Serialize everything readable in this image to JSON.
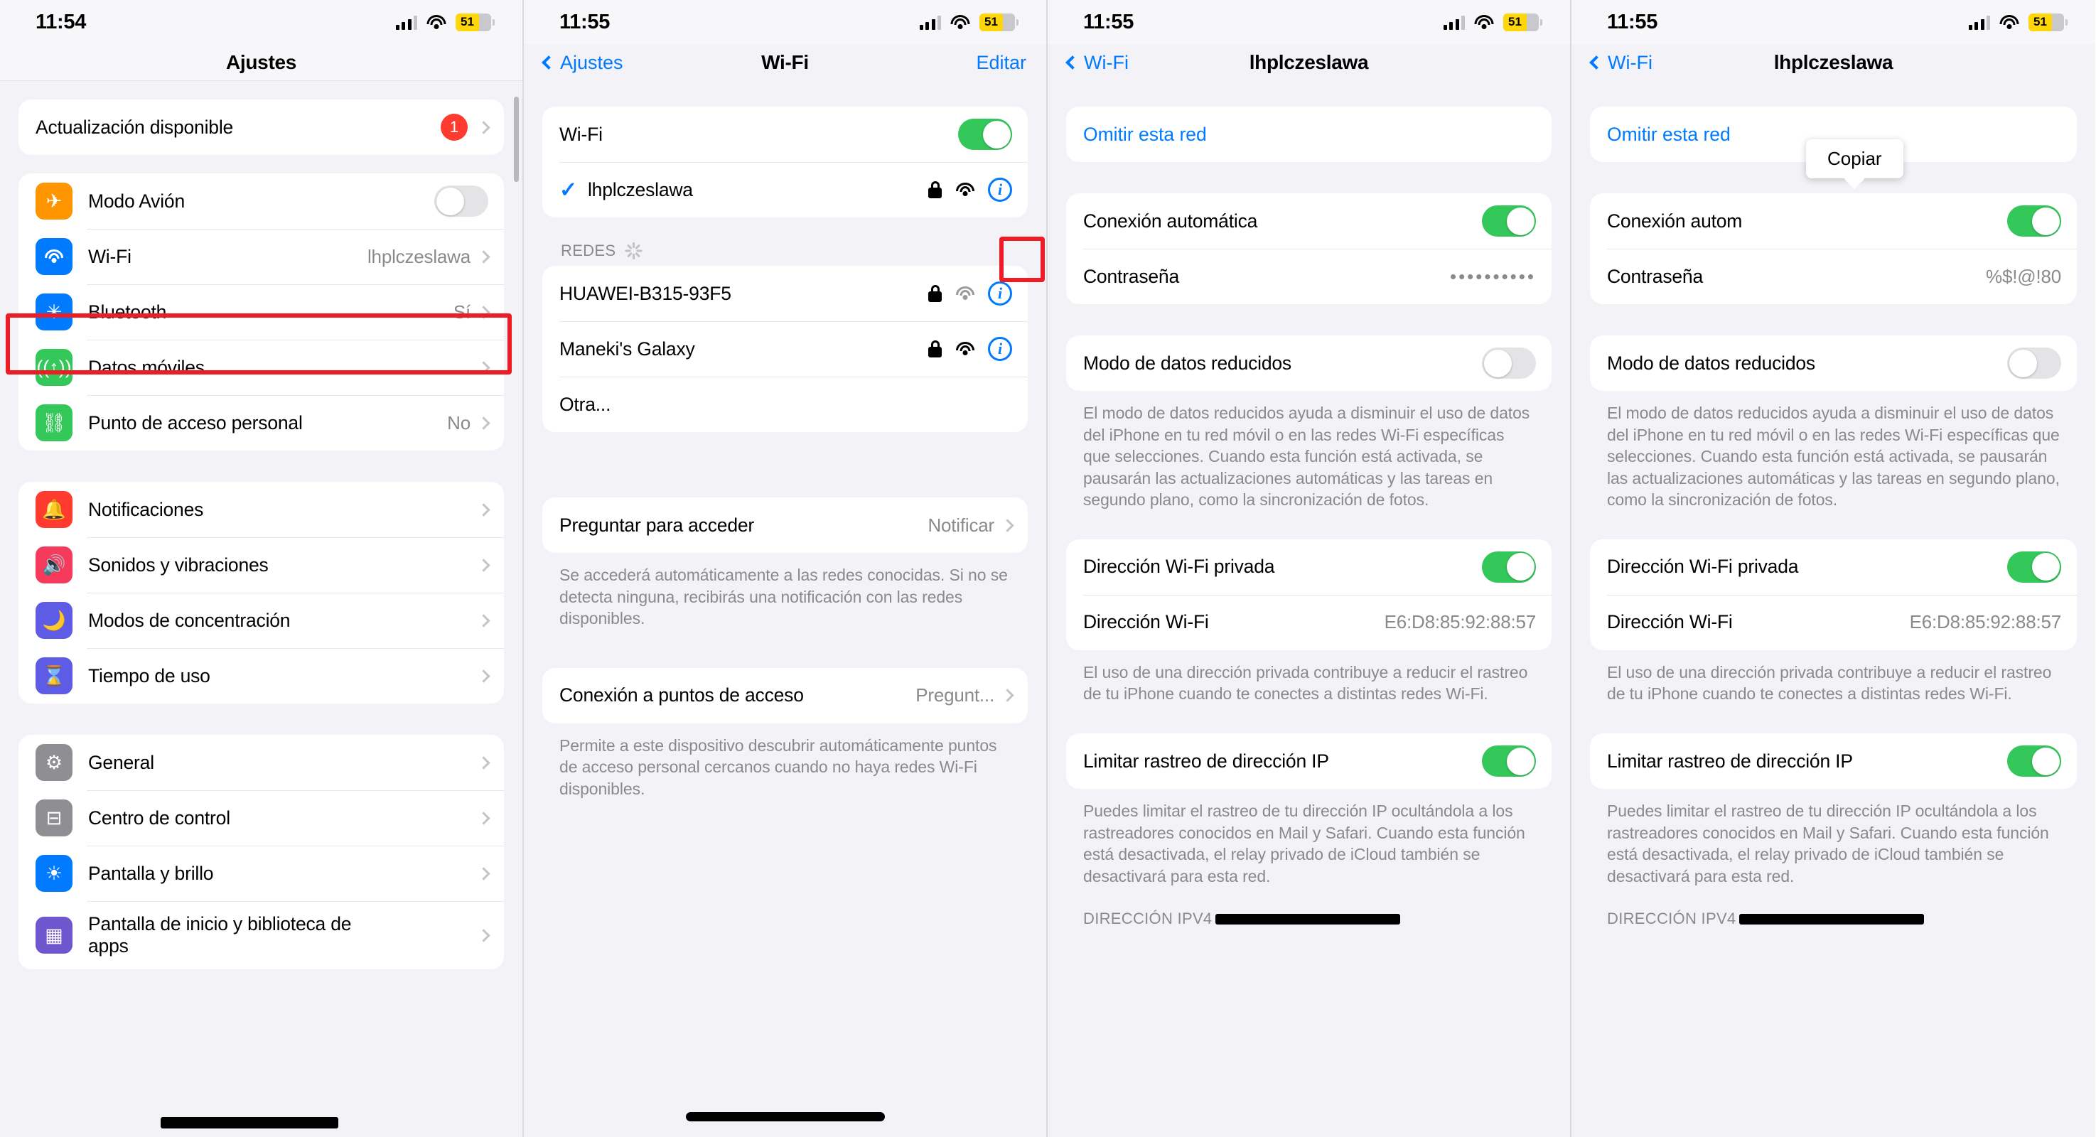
{
  "status_bar": {
    "time_p1": "11:54",
    "time_p2": "11:55",
    "time_p3": "11:55",
    "time_p4": "11:55",
    "battery": "51"
  },
  "panel1": {
    "title": "Ajustes",
    "update_row": {
      "label": "Actualización disponible",
      "badge": "1"
    },
    "group_connectivity": [
      {
        "label": "Modo Avión",
        "icon": "airplane-icon",
        "type": "toggle",
        "value": "off",
        "color": "#FF9500"
      },
      {
        "label": "Wi-Fi",
        "icon": "wifi-icon",
        "type": "value",
        "value": "lhplczeslawa",
        "color": "#007AFF"
      },
      {
        "label": "Bluetooth",
        "icon": "bluetooth-icon",
        "type": "value",
        "value": "Sí",
        "color": "#007AFF"
      },
      {
        "label": "Datos móviles",
        "icon": "cellular-icon",
        "type": "value",
        "value": "",
        "color": "#34C759"
      },
      {
        "label": "Punto de acceso personal",
        "icon": "hotspot-icon",
        "type": "value",
        "value": "No",
        "color": "#34C759"
      }
    ],
    "group_alerts": [
      {
        "label": "Notificaciones",
        "icon": "bell-icon",
        "color": "#FF3B30"
      },
      {
        "label": "Sonidos y vibraciones",
        "icon": "speaker-icon",
        "color": "#F63A5B"
      },
      {
        "label": "Modos de concentración",
        "icon": "moon-icon",
        "color": "#5E5CE6"
      },
      {
        "label": "Tiempo de uso",
        "icon": "hourglass-icon",
        "color": "#5E5CE6"
      }
    ],
    "group_system": [
      {
        "label": "General",
        "icon": "gear-icon",
        "color": "#8E8E93"
      },
      {
        "label": "Centro de control",
        "icon": "control-center-icon",
        "color": "#8E8E93"
      },
      {
        "label": "Pantalla y brillo",
        "icon": "brightness-icon",
        "color": "#007AFF"
      },
      {
        "label": "Pantalla de inicio y biblioteca de apps",
        "icon": "app-library-icon",
        "color": "#6E56CF"
      }
    ]
  },
  "panel2": {
    "back_label": "Ajustes",
    "title": "Wi-Fi",
    "edit_label": "Editar",
    "wifi_toggle_label": "Wi-Fi",
    "wifi_toggle_state": "on",
    "connected_network": "lhplczeslawa",
    "networks_header": "REDES",
    "networks": [
      {
        "name": "HUAWEI-B315-93F5",
        "secured": true,
        "signal": "weak"
      },
      {
        "name": "Maneki's Galaxy",
        "secured": true,
        "signal": "strong"
      },
      {
        "name": "Otra...",
        "secured": false,
        "signal": "none"
      }
    ],
    "ask_join_label": "Preguntar para acceder",
    "ask_join_value": "Notificar",
    "ask_join_note": "Se accederá automáticamente a las redes conocidas. Si no se detecta ninguna, recibirás una notificación con las redes disponibles.",
    "hotspot_label": "Conexión a puntos de acceso",
    "hotspot_value": "Pregunt...",
    "hotspot_note": "Permite a este dispositivo descubrir automáticamente puntos de acceso personal cercanos cuando no haya redes Wi-Fi disponibles."
  },
  "panel3": {
    "back_label": "Wi-Fi",
    "title": "lhplczeslawa",
    "forget_label": "Omitir esta red",
    "auto_join_label": "Conexión automática",
    "auto_join_state": "on",
    "password_label": "Contraseña",
    "password_value": "••••••••••",
    "low_data_label": "Modo de datos reducidos",
    "low_data_state": "off",
    "low_data_note": "El modo de datos reducidos ayuda a disminuir el uso de datos del iPhone en tu red móvil o en las redes Wi-Fi específicas que selecciones. Cuando esta función está activada, se pausarán las actualizaciones automáticas y las tareas en segundo plano, como la sincronización de fotos.",
    "private_addr_label": "Dirección Wi-Fi privada",
    "private_addr_state": "on",
    "wifi_addr_label": "Dirección Wi-Fi",
    "wifi_addr_value": "E6:D8:85:92:88:57",
    "private_addr_note": "El uso de una dirección privada contribuye a reducir el rastreo de tu iPhone cuando te conectes a distintas redes Wi-Fi.",
    "limit_ip_label": "Limitar rastreo de dirección IP",
    "limit_ip_state": "on",
    "limit_ip_note": "Puedes limitar el rastreo de tu dirección IP ocultándola a los rastreadores conocidos en Mail y Safari. Cuando esta función está desactivada, el relay privado de iCloud también se desactivará para esta red.",
    "ipv4_header": "DIRECCIÓN IPV4"
  },
  "panel4": {
    "back_label": "Wi-Fi",
    "title": "lhplczeslawa",
    "forget_label": "Omitir esta red",
    "auto_join_label": "Conexión autom",
    "auto_join_state": "on",
    "copy_tooltip": "Copiar",
    "password_label": "Contraseña",
    "password_value": "%$!@!80",
    "low_data_label": "Modo de datos reducidos",
    "low_data_state": "off",
    "low_data_note": "El modo de datos reducidos ayuda a disminuir el uso de datos del iPhone en tu red móvil o en las redes Wi-Fi específicas que selecciones. Cuando esta función está activada, se pausarán las actualizaciones automáticas y las tareas en segundo plano, como la sincronización de fotos.",
    "private_addr_label": "Dirección Wi-Fi privada",
    "private_addr_state": "on",
    "wifi_addr_label": "Dirección Wi-Fi",
    "wifi_addr_value": "E6:D8:85:92:88:57",
    "private_addr_note": "El uso de una dirección privada contribuye a reducir el rastreo de tu iPhone cuando te conectes a distintas redes Wi-Fi.",
    "limit_ip_label": "Limitar rastreo de dirección IP",
    "limit_ip_state": "on",
    "limit_ip_note": "Puedes limitar el rastreo de tu dirección IP ocultándola a los rastreadores conocidos en Mail y Safari. Cuando esta función está desactivada, el relay privado de iCloud también se desactivará para esta red.",
    "ipv4_header": "DIRECCIÓN IPV4"
  },
  "colors": {
    "accent": "#007AFF",
    "toggle_on": "#34C759",
    "badge": "#FF3B30",
    "annotation": "#EE1C24"
  }
}
